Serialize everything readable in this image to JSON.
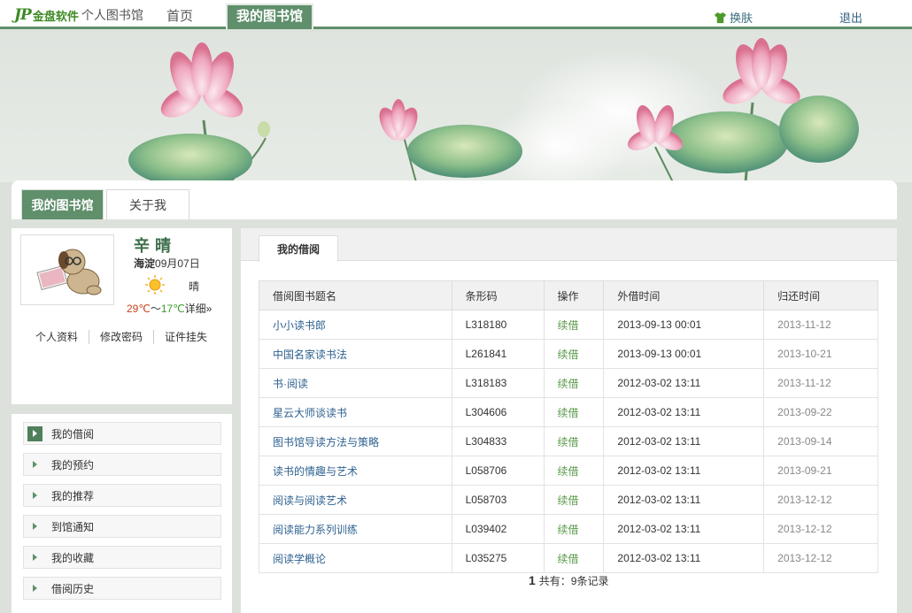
{
  "header": {
    "logo_mark": "JP",
    "logo_brand": "金盘软件",
    "logo_sub": "个人图书馆",
    "nav_home": "首页",
    "nav_mine": "我的图书馆",
    "skin": "换肤",
    "logout": "退出"
  },
  "tabs": {
    "mylib": "我的图书馆",
    "about": "关于我"
  },
  "profile": {
    "name": "辛晴",
    "weather_city": "海淀",
    "weather_date": "09月07日",
    "weather_text": "晴",
    "temp_high": "29℃",
    "temp_sep": "～",
    "temp_low": "17℃",
    "detail": "详细»",
    "links": [
      "个人资料",
      "修改密码",
      "证件挂失"
    ]
  },
  "menu": [
    {
      "label": "我的借阅",
      "active": true
    },
    {
      "label": "我的预约",
      "active": false
    },
    {
      "label": "我的推荐",
      "active": false
    },
    {
      "label": "到馆通知",
      "active": false
    },
    {
      "label": "我的收藏",
      "active": false
    },
    {
      "label": "借阅历史",
      "active": false
    }
  ],
  "main": {
    "tab": "我的借阅",
    "columns": [
      "借阅图书题名",
      "条形码",
      "操作",
      "外借时间",
      "归还时间"
    ],
    "rows": [
      {
        "title": "小小读书郎",
        "code": "L318180",
        "op": "续借",
        "borrow": "2013-09-13 00:01",
        "due": "2013-11-12"
      },
      {
        "title": "中国名家读书法",
        "code": "L261841",
        "op": "续借",
        "borrow": "2013-09-13 00:01",
        "due": "2013-10-21"
      },
      {
        "title": "书·阅读",
        "code": "L318183",
        "op": "续借",
        "borrow": "2012-03-02 13:11",
        "due": "2013-11-12"
      },
      {
        "title": "星云大师谈读书",
        "code": "L304606",
        "op": "续借",
        "borrow": "2012-03-02 13:11",
        "due": "2013-09-22"
      },
      {
        "title": "图书馆导读方法与策略",
        "code": "L304833",
        "op": "续借",
        "borrow": "2012-03-02 13:11",
        "due": "2013-09-14"
      },
      {
        "title": "读书的情趣与艺术",
        "code": "L058706",
        "op": "续借",
        "borrow": "2012-03-02 13:11",
        "due": "2013-09-21"
      },
      {
        "title": "阅读与阅读艺术",
        "code": "L058703",
        "op": "续借",
        "borrow": "2012-03-02 13:11",
        "due": "2013-12-12"
      },
      {
        "title": "阅读能力系列训练",
        "code": "L039402",
        "op": "续借",
        "borrow": "2012-03-02 13:11",
        "due": "2013-12-12"
      },
      {
        "title": "阅读学概论",
        "code": "L035275",
        "op": "续借",
        "borrow": "2012-03-02 13:11",
        "due": "2013-12-12"
      }
    ],
    "pager_page": "1",
    "pager_text": "共有：9条记录"
  }
}
